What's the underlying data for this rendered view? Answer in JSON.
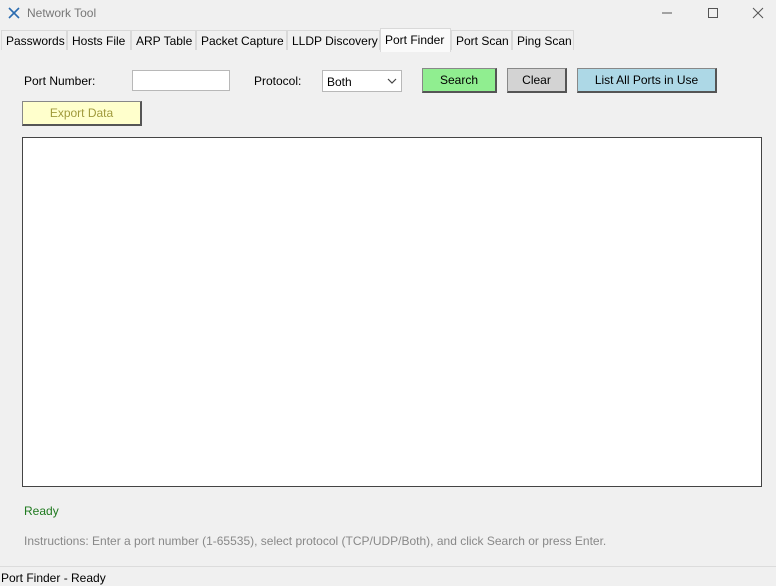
{
  "window": {
    "title": "Network Tool",
    "minimize_icon": "minimize-icon",
    "maximize_icon": "maximize-icon",
    "close_icon": "close-icon"
  },
  "tabs": [
    {
      "label": "Passwords"
    },
    {
      "label": "Hosts File"
    },
    {
      "label": "ARP Table"
    },
    {
      "label": "Packet Capture"
    },
    {
      "label": "LLDP Discovery"
    },
    {
      "label": "Port Finder",
      "active": true
    },
    {
      "label": "Port Scan"
    },
    {
      "label": "Ping Scan"
    }
  ],
  "form": {
    "port_label": "Port Number:",
    "port_value": "",
    "protocol_label": "Protocol:",
    "protocol_value": "Both"
  },
  "buttons": {
    "search": "Search",
    "clear": "Clear",
    "list_all": "List All Ports in Use",
    "export": "Export Data"
  },
  "colors": {
    "search_bg": "#90ee90",
    "clear_bg": "#d3d3d3",
    "list_all_bg": "#add8e6",
    "export_bg": "#ffffcc",
    "export_text": "#a09a3c",
    "ready_text": "#1f7a1f"
  },
  "status": {
    "ready": "Ready",
    "instructions": "Instructions: Enter a port number (1-65535), select protocol (TCP/UDP/Both), and click Search or press Enter."
  },
  "statusbar": {
    "text": "Port Finder - Ready"
  }
}
